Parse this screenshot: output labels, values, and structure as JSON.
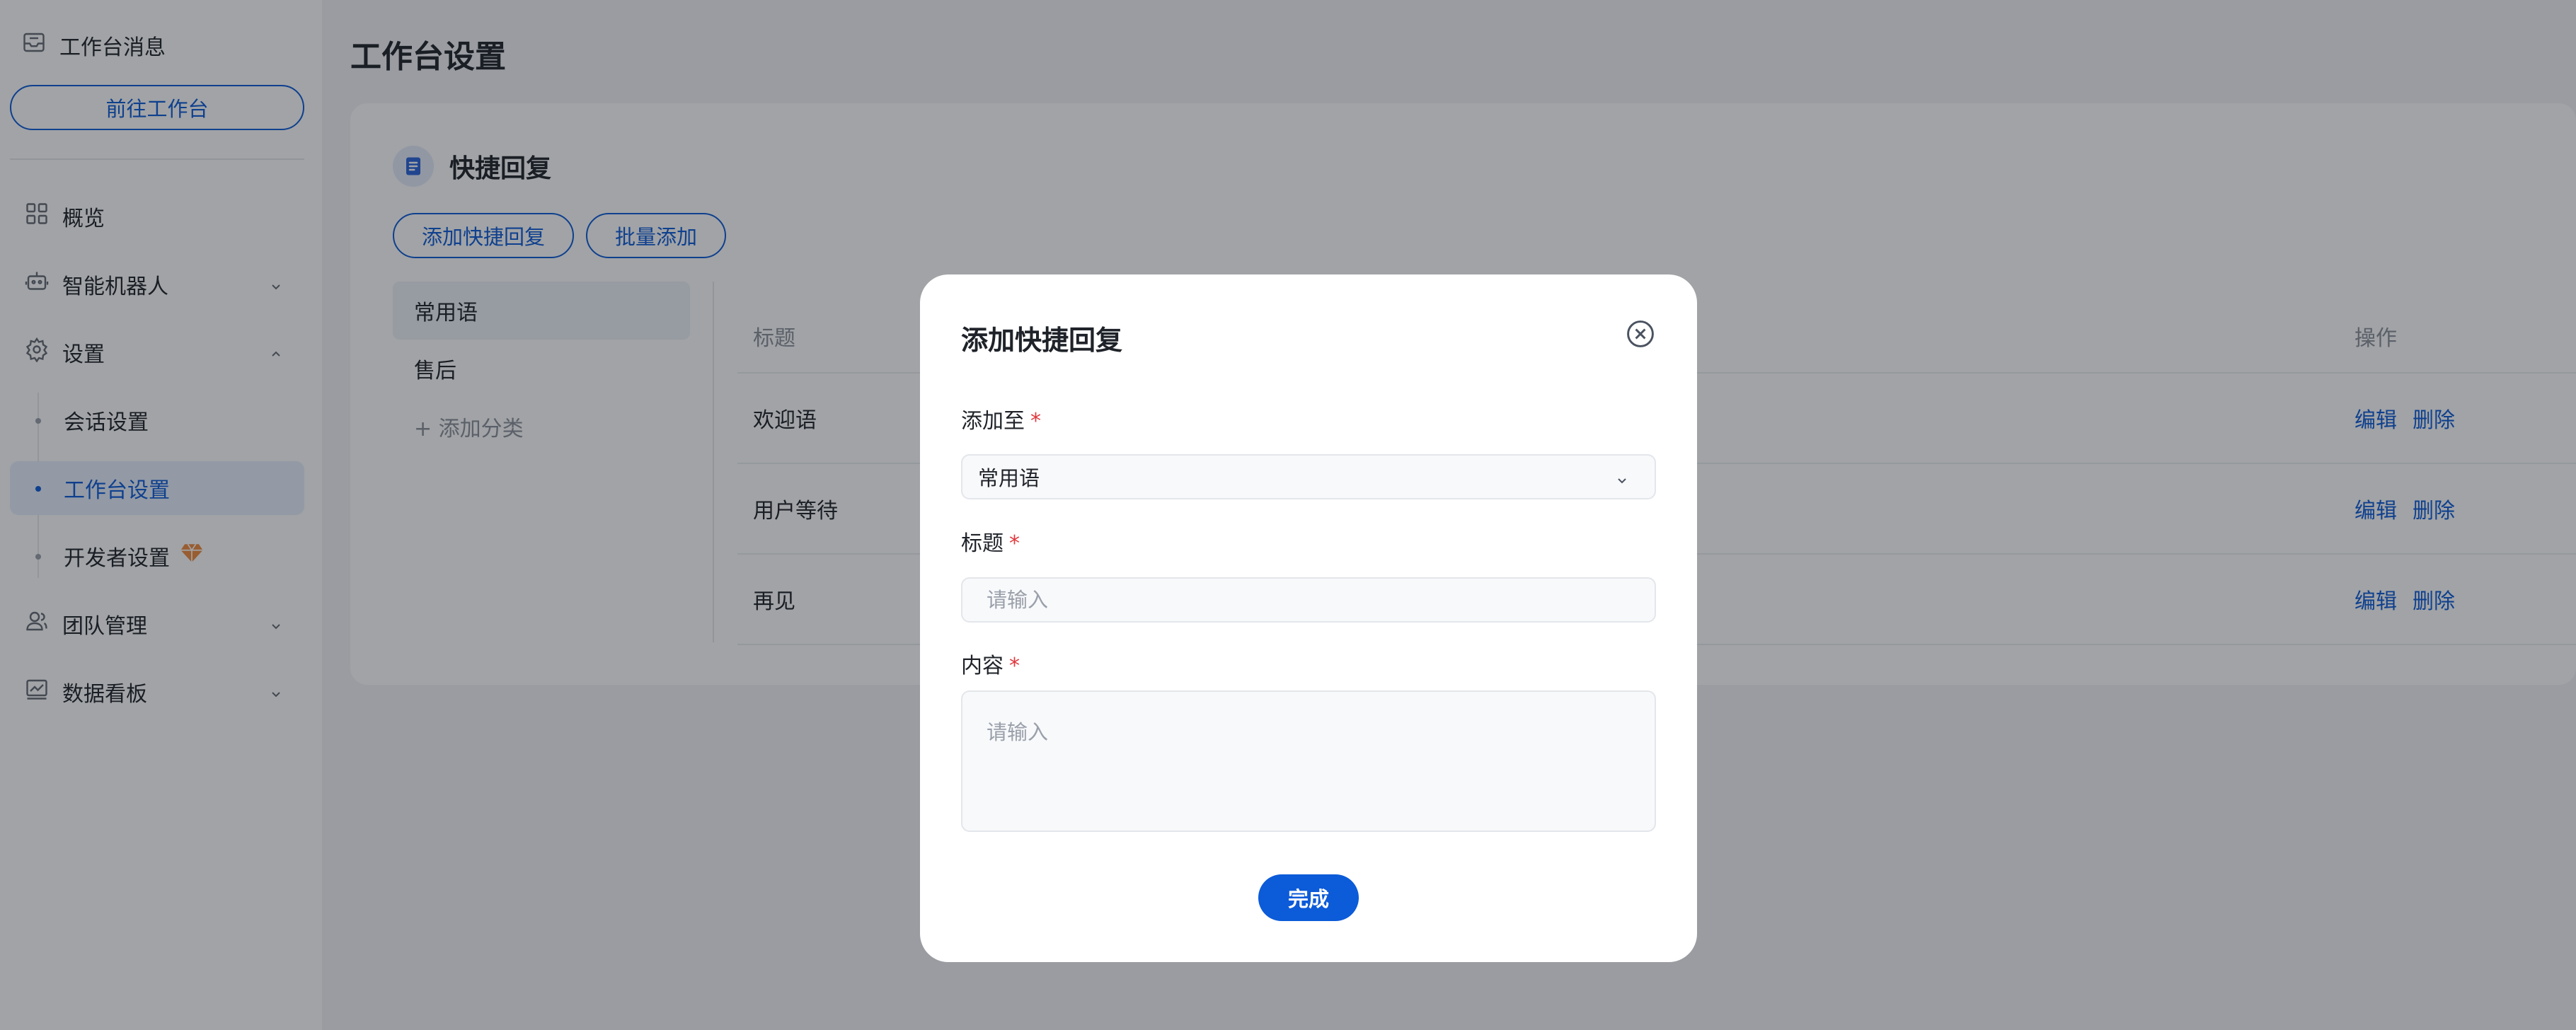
{
  "sidebar": {
    "messages": "工作台消息",
    "goto_workbench": "前往工作台",
    "items": {
      "overview": "概览",
      "robot": "智能机器人",
      "settings": "设置",
      "team": "团队管理",
      "dashboard": "数据看板"
    },
    "settings_sub": {
      "session": "会话设置",
      "workbench": "工作台设置",
      "developer": "开发者设置"
    }
  },
  "page": {
    "title": "工作台设置",
    "card_title": "快捷回复",
    "add_quick_reply": "添加快捷回复",
    "batch_add": "批量添加",
    "categories": [
      "常用语",
      "售后"
    ],
    "add_category": "+ 添加分类",
    "table": {
      "col_title": "标题",
      "col_ops": "操作",
      "rows": [
        {
          "title": "欢迎语"
        },
        {
          "title": "用户等待"
        },
        {
          "title": "再见"
        }
      ],
      "edit": "编辑",
      "delete": "删除"
    }
  },
  "modal": {
    "title": "添加快捷回复",
    "add_to_label": "添加至",
    "add_to_value": "常用语",
    "title_label": "标题",
    "title_placeholder": "请输入",
    "content_label": "内容",
    "content_placeholder": "请输入",
    "required_mark": "*",
    "done": "完成"
  },
  "colors": {
    "primary": "#0c5bd8",
    "required": "#e0393e",
    "overlay": "rgba(20,24,33,0.4)"
  }
}
